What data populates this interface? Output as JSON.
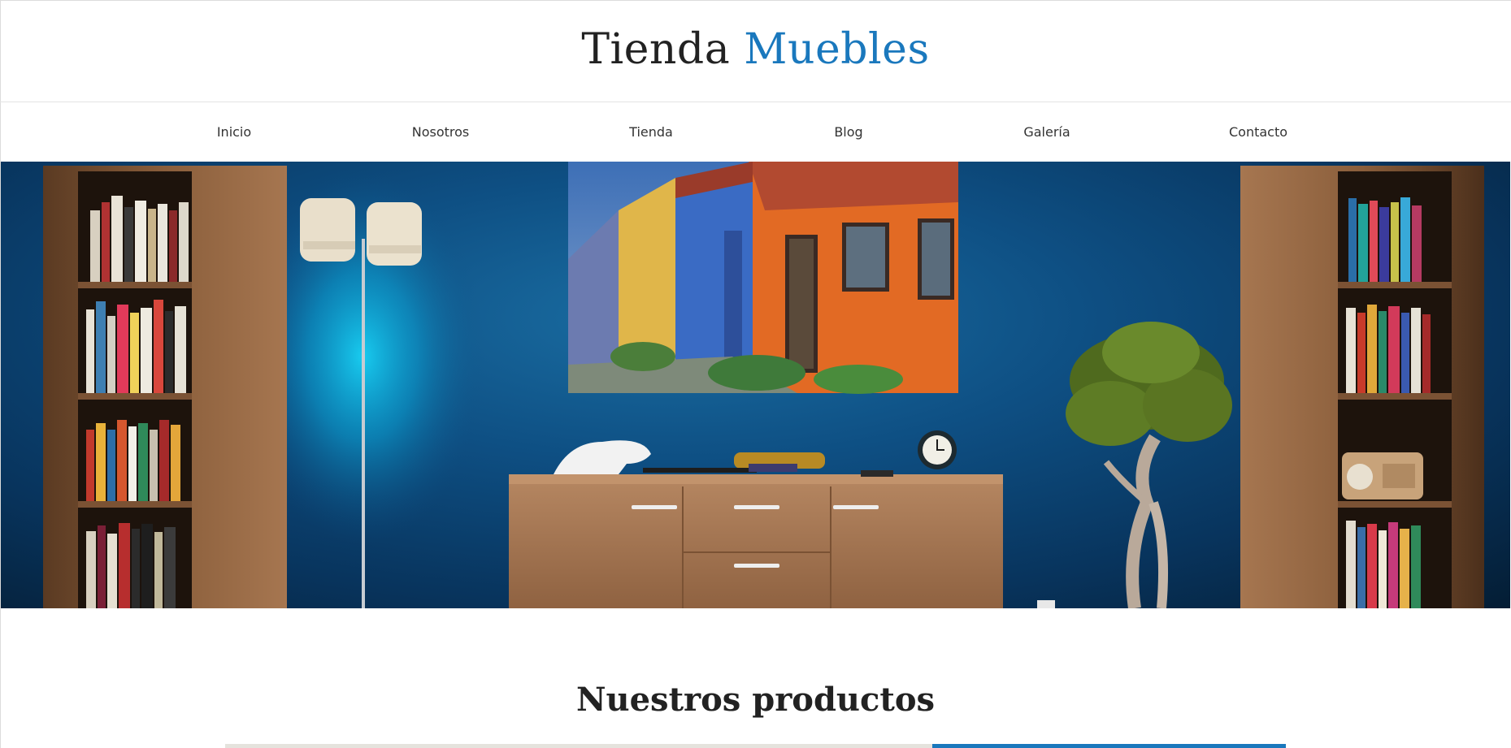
{
  "header": {
    "logo_part1": "Tienda",
    "logo_part2": "Muebles",
    "accent_color": "#1a78bd"
  },
  "nav": {
    "items": [
      {
        "label": "Inicio"
      },
      {
        "label": "Nosotros"
      },
      {
        "label": "Tienda"
      },
      {
        "label": "Blog"
      },
      {
        "label": "Galería"
      },
      {
        "label": "Contacto"
      }
    ]
  },
  "hero": {
    "image": "living-room-photo",
    "wall_color": "#0e4f83"
  },
  "products": {
    "title": "Nuestros productos"
  }
}
